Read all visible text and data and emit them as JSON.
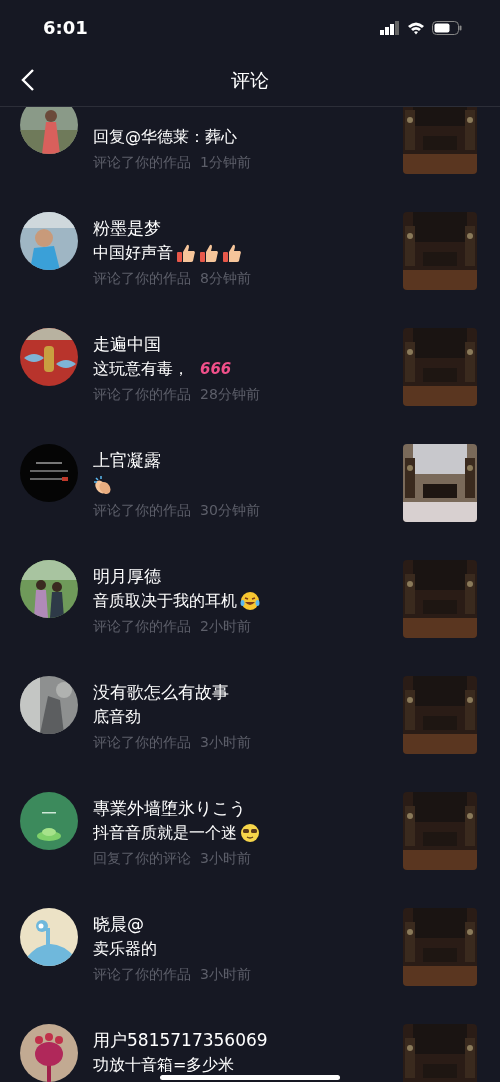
{
  "status_bar": {
    "time": "6:01"
  },
  "header": {
    "title": "评论"
  },
  "notifications": [
    {
      "comment": "回复@华德莱：葬心",
      "meta": "评论了你的作品",
      "time": "1分钟前"
    },
    {
      "name": "粉墨是梦",
      "comment": "中国好声音",
      "stickers": [
        {
          "kind": "thumb"
        },
        {
          "kind": "thumb"
        },
        {
          "kind": "thumb"
        }
      ],
      "meta": "评论了你的作品",
      "time": "8分钟前"
    },
    {
      "name": "走遍中国",
      "comment": "这玩意有毒，",
      "stickers": [
        {
          "kind": "label",
          "text": "666"
        }
      ],
      "meta": "评论了你的作品",
      "time": "28分钟前"
    },
    {
      "name": "上官凝露",
      "stickers": [
        {
          "kind": "clap"
        }
      ],
      "meta": "评论了你的作品",
      "time": "30分钟前"
    },
    {
      "name": "明月厚德",
      "comment": "音质取决于我的耳机",
      "stickers": [
        {
          "kind": "laugh"
        }
      ],
      "meta": "评论了你的作品",
      "time": "2小时前"
    },
    {
      "name": "没有歌怎么有故事",
      "comment": "底音劲",
      "meta": "评论了你的作品",
      "time": "3小时前"
    },
    {
      "name": "專業外墙堕氷りこう",
      "comment": "抖音音质就是一个迷",
      "stickers": [
        {
          "kind": "cool"
        }
      ],
      "meta": "回复了你的评论",
      "time": "3小时前"
    },
    {
      "name": "晓晨@",
      "comment": "卖乐器的",
      "meta": "评论了你的作品",
      "time": "3小时前"
    },
    {
      "name": "用户5815717356069",
      "comment": "功放十音箱=多少米"
    }
  ]
}
